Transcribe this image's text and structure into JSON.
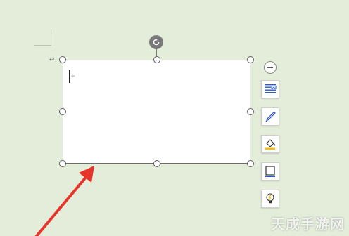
{
  "document": {
    "paragraph_mark": "↵",
    "textbox_paragraph_mark": "↵"
  },
  "layout_options": {
    "collapse_icon": "minus-circle-icon",
    "buttons": [
      {
        "name": "layout-options-button",
        "icon": "wrap-text-icon"
      },
      {
        "name": "shape-outline-button",
        "icon": "pen-icon"
      },
      {
        "name": "shape-fill-button",
        "icon": "paint-bucket-icon"
      },
      {
        "name": "shape-styles-button",
        "icon": "frame-icon"
      },
      {
        "name": "tell-me-button",
        "icon": "lightbulb-icon"
      }
    ]
  },
  "colors": {
    "background": "#e3edd9",
    "arrow": "#e8352c",
    "handle_border": "#5f5f5f",
    "accent_blue": "#2b58c6",
    "accent_yellow": "#f2c200"
  },
  "watermark": "天成手游网"
}
